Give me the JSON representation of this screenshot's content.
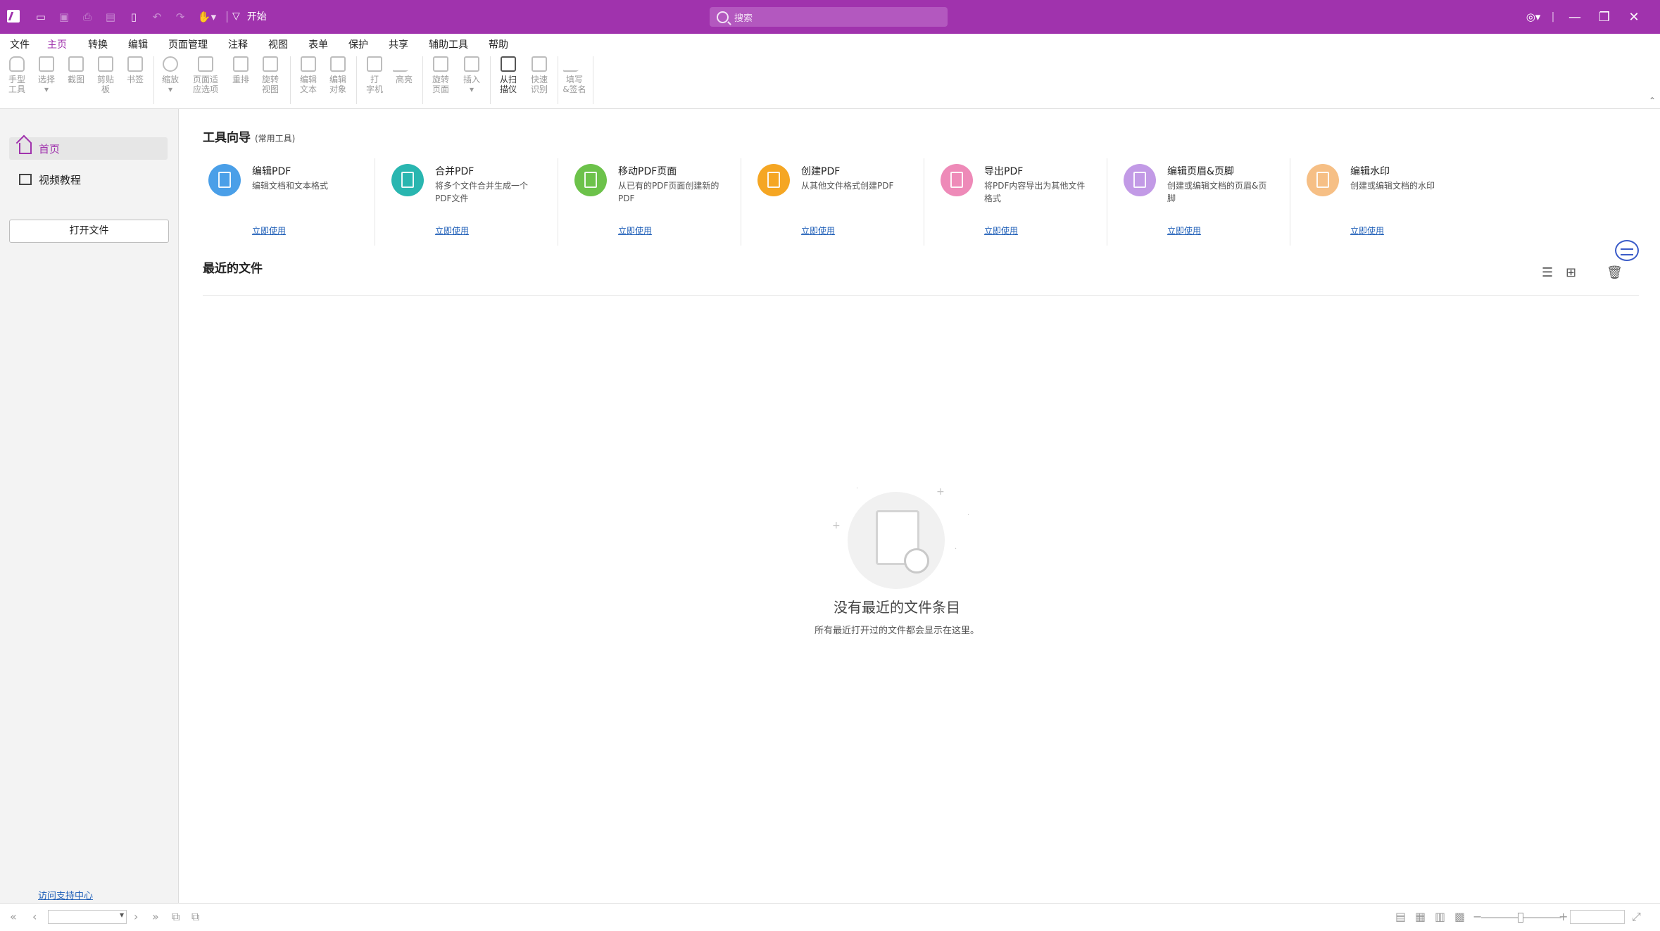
{
  "titlebar": {
    "start_label": "开始",
    "search_placeholder": "搜索",
    "accent": "#a033ad"
  },
  "menu": [
    "文件",
    "主页",
    "转换",
    "编辑",
    "页面管理",
    "注释",
    "视图",
    "表单",
    "保护",
    "共享",
    "辅助工具",
    "帮助"
  ],
  "menu_active": "主页",
  "ribbon": [
    {
      "l1": "手型",
      "l2": "工具",
      "icon": "hand-icon"
    },
    {
      "l1": "选择",
      "l2": "",
      "icon": "select-text-icon"
    },
    {
      "l1": "截图",
      "l2": "",
      "icon": "snapshot-icon"
    },
    {
      "l1": "剪贴",
      "l2": "板",
      "icon": "clipboard-icon"
    },
    {
      "l1": "书签",
      "l2": "",
      "icon": "bookmark-icon"
    },
    {
      "l1": "缩放",
      "l2": "",
      "icon": "zoom-icon"
    },
    {
      "l1": "页面适",
      "l2": "应选项",
      "icon": "fit-page-icon"
    },
    {
      "l1": "重排",
      "l2": "",
      "icon": "reflow-icon"
    },
    {
      "l1": "旋转",
      "l2": "视图",
      "icon": "rotate-view-icon"
    },
    {
      "l1": "编辑",
      "l2": "文本",
      "icon": "edit-text-icon"
    },
    {
      "l1": "编辑",
      "l2": "对象",
      "icon": "edit-object-icon"
    },
    {
      "l1": "打",
      "l2": "字机",
      "icon": "typewriter-icon"
    },
    {
      "l1": "高亮",
      "l2": "",
      "icon": "highlight-icon"
    },
    {
      "l1": "旋转",
      "l2": "页面",
      "icon": "rotate-page-icon"
    },
    {
      "l1": "插入",
      "l2": "",
      "icon": "insert-icon"
    },
    {
      "l1": "从扫",
      "l2": "描仪",
      "icon": "scanner-icon"
    },
    {
      "l1": "快速",
      "l2": "识别",
      "icon": "ocr-icon"
    },
    {
      "l1": "填写",
      "l2": "&签名",
      "icon": "fill-sign-icon"
    }
  ],
  "sidebar": {
    "items": [
      {
        "label": "首页",
        "icon": "home-icon"
      },
      {
        "label": "视频教程",
        "icon": "video-icon"
      }
    ],
    "open_file": "打开文件",
    "support_link": "访问支持中心"
  },
  "tool_guide": {
    "title": "工具向导",
    "subtitle": "(常用工具)",
    "link_label": "立即使用",
    "tools": [
      {
        "name": "编辑PDF",
        "desc": "编辑文档和文本格式",
        "color": "#4a9fe8"
      },
      {
        "name": "合并PDF",
        "desc": "将多个文件合并生成一个PDF文件",
        "color": "#29b6b0"
      },
      {
        "name": "移动PDF页面",
        "desc": "从已有的PDF页面创建新的PDF",
        "color": "#6cc24a"
      },
      {
        "name": "创建PDF",
        "desc": "从其他文件格式创建PDF",
        "color": "#f5a623"
      },
      {
        "name": "导出PDF",
        "desc": "将PDF内容导出为其他文件格式",
        "color": "#ee8ab8"
      },
      {
        "name": "编辑页眉&页脚",
        "desc": "创建或编辑文档的页眉&页脚",
        "color": "#c29ae6"
      },
      {
        "name": "编辑水印",
        "desc": "创建或编辑文档的水印",
        "color": "#f6bf85"
      }
    ]
  },
  "recent": {
    "title": "最近的文件",
    "empty_title": "没有最近的文件条目",
    "empty_sub": "所有最近打开过的文件都会显示在这里。"
  }
}
